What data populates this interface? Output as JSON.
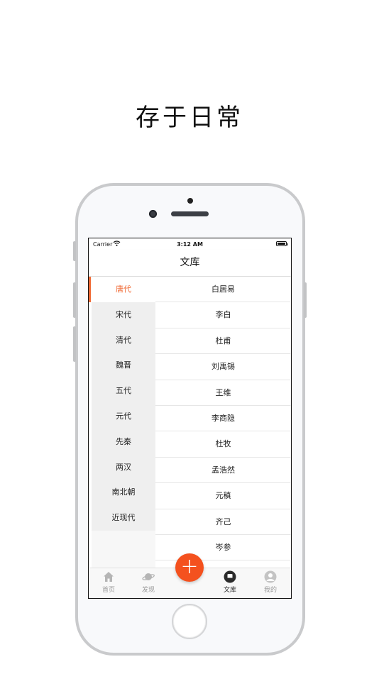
{
  "headline": "存于日常",
  "status_bar": {
    "carrier": "Carrier",
    "time": "3:12 AM"
  },
  "nav": {
    "title": "文库"
  },
  "dynasties": [
    "唐代",
    "宋代",
    "清代",
    "魏晋",
    "五代",
    "元代",
    "先秦",
    "两汉",
    "南北朝",
    "近现代"
  ],
  "selected_dynasty": "唐代",
  "poets": [
    "白居易",
    "李白",
    "杜甫",
    "刘禹锡",
    "王维",
    "李商隐",
    "杜牧",
    "孟浩然",
    "元稹",
    "齐己",
    "岑参"
  ],
  "fab": {
    "icon": "plus-icon",
    "label": "+"
  },
  "tabs": [
    {
      "label": "首页",
      "icon": "home-icon"
    },
    {
      "label": "发现",
      "icon": "planet-icon"
    },
    {
      "label": "文库",
      "icon": "library-icon",
      "active": true
    },
    {
      "label": "我的",
      "icon": "person-icon"
    }
  ],
  "colors": {
    "accent": "#f06a35",
    "fab": "#f4511e"
  }
}
